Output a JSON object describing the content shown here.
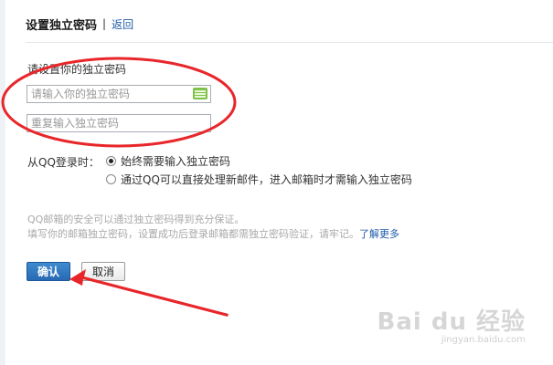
{
  "header": {
    "title": "设置独立密码",
    "separator": "|",
    "back": "返回"
  },
  "form": {
    "set_label": "请设置你的独立密码",
    "password_placeholder": "请输入你的独立密码",
    "confirm_placeholder": "重复输入独立密码",
    "keyboard_icon": "virtual-keyboard-icon"
  },
  "login": {
    "label": "从QQ登录时：",
    "options": [
      {
        "label": "始终需要输入独立密码",
        "checked": true
      },
      {
        "label": "通过QQ可以直接处理新邮件，进入邮箱时才需输入独立密码",
        "checked": false
      }
    ]
  },
  "info": {
    "line1": "QQ邮箱的安全可以通过独立密码得到充分保证。",
    "line2": "填写你的邮箱独立密码，设置成功后登录邮箱都需独立密码验证，请牢记。",
    "learn_more": "了解更多"
  },
  "buttons": {
    "confirm": "确认",
    "cancel": "取消"
  },
  "watermark": {
    "main": "Bai du 经验",
    "sub": "jingyan.baidu.com"
  },
  "colors": {
    "accent": "#2769b3",
    "link": "#1e5aa8",
    "annotation": "#e8262a"
  }
}
